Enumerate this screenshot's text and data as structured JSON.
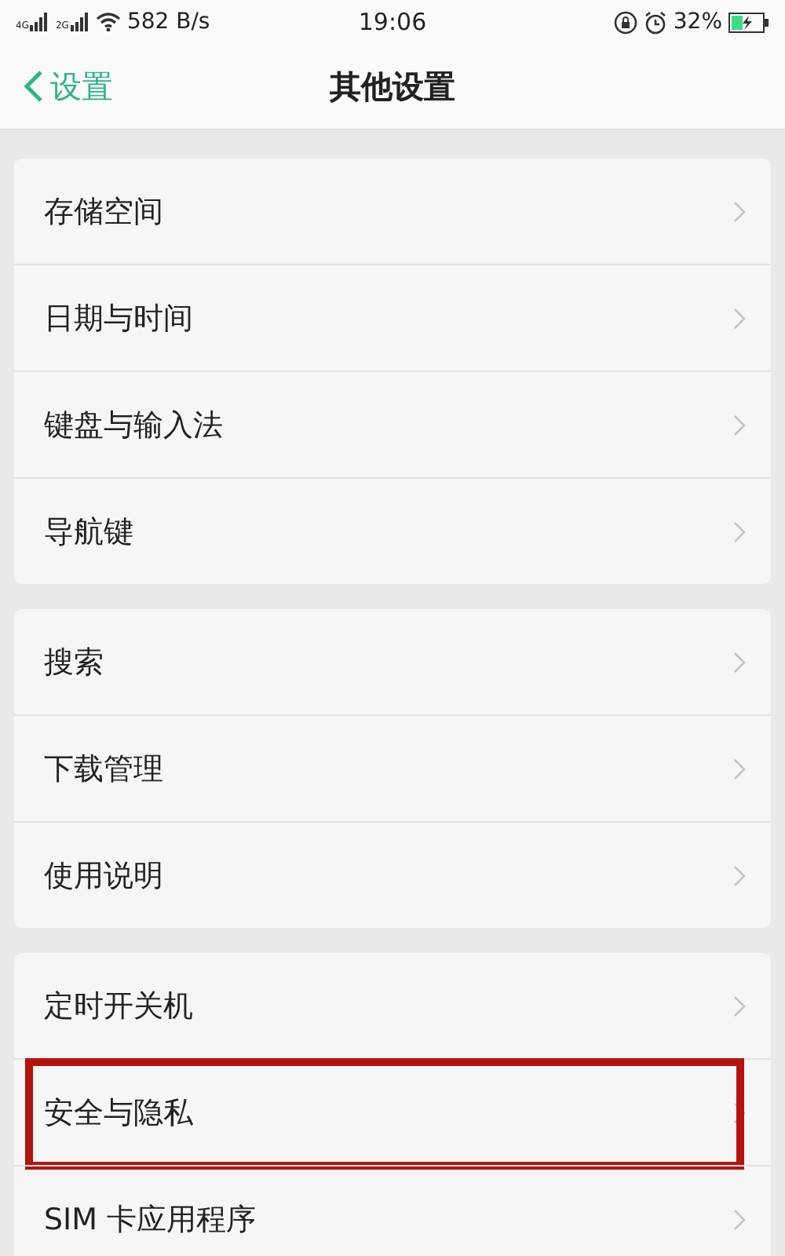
{
  "status_bar": {
    "network_1": "4G",
    "network_2": "2G",
    "speed": "582 B/s",
    "time": "19:06",
    "battery": "32%"
  },
  "header": {
    "back": "设置",
    "title": "其他设置"
  },
  "groups": [
    {
      "items": [
        {
          "label": "存储空间",
          "highlighted": false
        },
        {
          "label": "日期与时间",
          "highlighted": false
        },
        {
          "label": "键盘与输入法",
          "highlighted": false
        },
        {
          "label": "导航键",
          "highlighted": false
        }
      ]
    },
    {
      "items": [
        {
          "label": "搜索",
          "highlighted": false
        },
        {
          "label": "下载管理",
          "highlighted": false
        },
        {
          "label": "使用说明",
          "highlighted": false
        }
      ]
    },
    {
      "items": [
        {
          "label": "定时开关机",
          "highlighted": false
        },
        {
          "label": "安全与隐私",
          "highlighted": true
        },
        {
          "label": "SIM 卡应用程序",
          "highlighted": false
        }
      ]
    }
  ]
}
